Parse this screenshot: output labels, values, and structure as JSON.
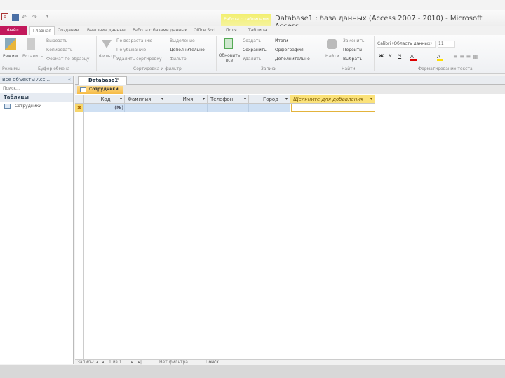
{
  "window": {
    "title": "Database1 : база данных (Access 2007 - 2010) - Microsoft Access",
    "context_group": "Работа с таблицами"
  },
  "ribbon_tabs": [
    "Файл",
    "Главная",
    "Создание",
    "Внешние данные",
    "Работа с базами данных",
    "Office Sort",
    "Поля",
    "Таблица"
  ],
  "ribbon": {
    "views": {
      "label": "Режимы",
      "button": "Режим"
    },
    "clipboard": {
      "label": "Буфер обмена",
      "paste": "Вставить",
      "cut": "Вырезать",
      "copy": "Копировать",
      "format_painter": "Формат по образцу"
    },
    "sort_filter": {
      "label": "Сортировка и фильтр",
      "filter": "Фильтр",
      "asc": "По возрастанию",
      "desc": "По убыванию",
      "clear_sort": "Удалить сортировку",
      "selection": "Выделение",
      "advanced": "Дополнительно",
      "toggle": "Фильтр"
    },
    "records": {
      "label": "Записи",
      "refresh": "Обновить все",
      "new": "Создать",
      "save": "Сохранить",
      "delete": "Удалить",
      "totals": "Итоги",
      "spelling": "Орфография",
      "more": "Дополнительно"
    },
    "find": {
      "label": "Найти",
      "find": "Найти",
      "replace": "Заменить",
      "goto": "Перейти",
      "select": "Выбрать"
    },
    "text_formatting": {
      "label": "Форматирование текста",
      "font": "Calibri (Область данных)",
      "size": "11",
      "bold": "Ж",
      "italic": "К",
      "underline": "Ч"
    }
  },
  "nav": {
    "title": "Все объекты Acc...",
    "search_placeholder": "Поиск...",
    "section": "Таблицы",
    "items": [
      "Сотрудники"
    ]
  },
  "doc_tab": "Database1",
  "table_tab": "Сотрудники",
  "columns": [
    "Код",
    "Фамилия",
    "Имя",
    "Телефон",
    "Город",
    "Щелкните для добавления"
  ],
  "new_row": {
    "id": "(№)"
  },
  "status": {
    "record_label": "Запись:",
    "record_pos": "1 из 1",
    "filter": "Нет фильтра",
    "search": "Поиск"
  }
}
